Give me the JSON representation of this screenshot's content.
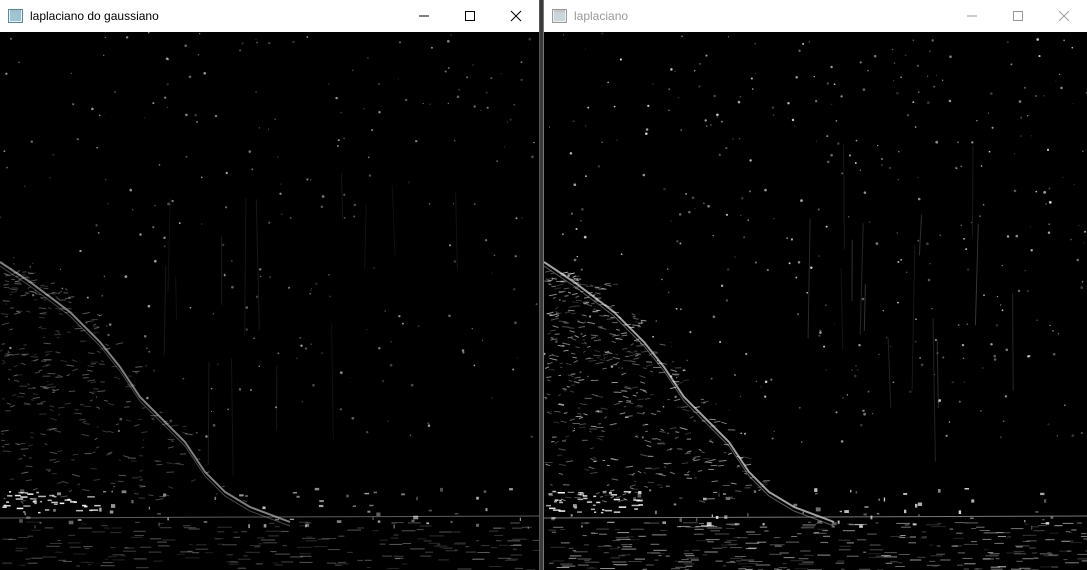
{
  "windows": {
    "left": {
      "title": "laplaciano do gaussiano",
      "active": true,
      "image": "edge-detection-output-log"
    },
    "right": {
      "title": "laplaciano",
      "active": false,
      "image": "edge-detection-output-laplacian"
    }
  },
  "controls": {
    "minimize": "minimize-icon",
    "maximize": "maximize-icon",
    "close": "close-icon"
  },
  "colors": {
    "titlebar_bg": "#ffffff",
    "active_title": "#000000",
    "inactive_title": "#999999",
    "image_bg": "#000000",
    "edge": "#ffffff"
  }
}
